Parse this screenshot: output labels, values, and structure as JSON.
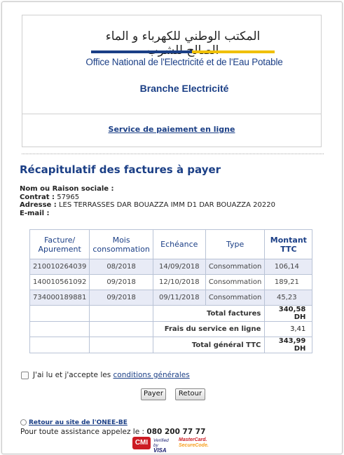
{
  "header": {
    "logo_arabic": "المكتب الوطني للكهرباء و الماء الصالح للشرب",
    "logo_french": "Office National de l'Electricité et de l'Eau Potable",
    "branch": "Branche Electricité",
    "service_link": "Service de paiement en ligne"
  },
  "title": "Récapitulatif des factures à payer",
  "client": {
    "name_label": "Nom ou Raison sociale :",
    "name_value": "",
    "contract_label": "Contrat :",
    "contract_value": "57965",
    "address_label": "Adresse :",
    "address_value": "LES TERRASSES DAR BOUAZZA IMM D1 DAR BOUAZZA 20220",
    "email_label": "E-mail :",
    "email_value": ""
  },
  "table": {
    "headers": [
      "Facture/ Apurement",
      "Mois consommation",
      "Echéance",
      "Type",
      "Montant TTC"
    ],
    "rows": [
      {
        "facture": "210010264039",
        "mois": "08/2018",
        "echeance": "14/09/2018",
        "type": "Consommation",
        "montant": "106,14"
      },
      {
        "facture": "140010561092",
        "mois": "09/2018",
        "echeance": "12/10/2018",
        "type": "Consommation",
        "montant": "189,21"
      },
      {
        "facture": "734000189881",
        "mois": "09/2018",
        "echeance": "09/11/2018",
        "type": "Consommation",
        "montant": "45,23"
      }
    ],
    "total_label": "Total factures",
    "total_value": "340,58 DH",
    "fees_label": "Frais du service en ligne",
    "fees_value": "3,41",
    "grand_label": "Total général TTC",
    "grand_value": "343,99 DH"
  },
  "accept": {
    "text": "J'ai lu et j'accepte les",
    "link": "conditions générales",
    "checked": false
  },
  "buttons": {
    "pay": "Payer",
    "back": "Retour"
  },
  "footer": {
    "back_link": "Retour au site de l'ONEE-BE",
    "assist_text": "Pour toute assistance appelez le :",
    "phone": "080 200 77 77",
    "logo_cmi": "CMI",
    "logo_visa_top": "Verified by",
    "logo_visa_bottom": "VISA",
    "logo_mc_top": "MasterCard.",
    "logo_mc_bottom": "SecureCode."
  },
  "colors": {
    "brand_blue": "#1b3f86",
    "row_shade": "#e8ebf6",
    "cmi_red": "#cc1c24"
  }
}
